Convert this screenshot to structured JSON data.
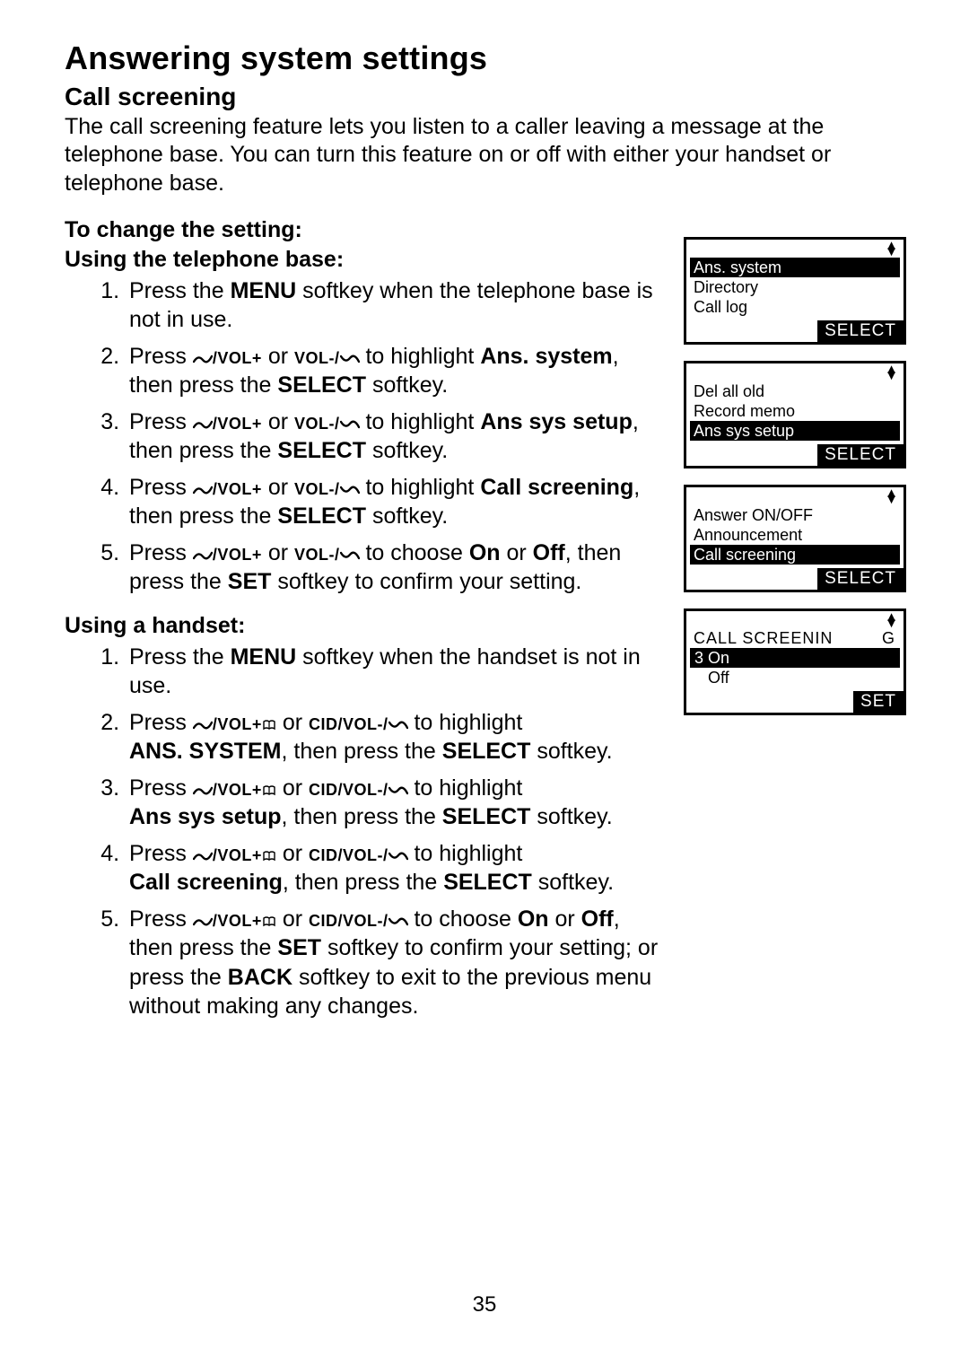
{
  "page_number": "35",
  "title": "Answering system settings",
  "section": "Call screening",
  "intro": "The call screening feature lets you listen to a caller leaving a message at the telephone base. You can turn this feature on or off with either your handset or telephone base.",
  "labels": {
    "to_change": "To change the setting:",
    "using_base": "Using the telephone base:",
    "using_handset": "Using a handset:"
  },
  "keys": {
    "vol_plus": "/VOL+",
    "vol_minus": "VOL-/",
    "cid_vol_minus": "CID/VOL-/",
    "menu": "MENU",
    "select": "SELECT",
    "set": "SET",
    "back": "BACK",
    "on": "On",
    "off": "Off"
  },
  "base_steps_text": {
    "s1a": "Press the ",
    "s1b": " softkey when the telephone base is not in use.",
    "s2a": "Press ",
    "s2b": " or ",
    "s2c": " to highlight ",
    "s2d": "Ans. system",
    "s2e": ", then press the ",
    "s2f": " softkey.",
    "s3d": "Ans sys setup",
    "s4d": "Call screening",
    "s5c": " to choose ",
    "s5e": ", then press the ",
    "s5f": " softkey to confirm your setting."
  },
  "handset_steps_text": {
    "s1a": "Press the ",
    "s1b": " softkey when the handset is not in use.",
    "s2a": "Press ",
    "s2b": " or ",
    "s2c": " to highlight ",
    "s2d": "ANS. SYSTEM",
    "s2e": ", then press the ",
    "s2f": " softkey.",
    "s3d": "Ans sys setup",
    "s4d": "Call screening",
    "s5c": " to choose ",
    "s5e": ", then press the ",
    "s5f": " softkey to confirm your setting; or press the ",
    "s5g": " softkey to exit to the previous menu without making any changes."
  },
  "screens": [
    {
      "rows": [
        "Ans. system",
        "Directory",
        "Call log"
      ],
      "highlight_index": 0,
      "soft": "SELECT"
    },
    {
      "rows": [
        "Del all old",
        "Record memo",
        "Ans sys setup"
      ],
      "highlight_index": 2,
      "soft": "SELECT"
    },
    {
      "rows": [
        "Answer ON/OFF",
        "Announcement",
        "Call screening"
      ],
      "highlight_index": 2,
      "soft": "SELECT"
    },
    {
      "title_l": "CALL SCREENIN",
      "title_r": "G",
      "options": [
        {
          "marker": "3",
          "label": "On",
          "hl": true
        },
        {
          "marker": "",
          "label": "Off",
          "hl": false
        }
      ],
      "soft": "SET"
    }
  ]
}
